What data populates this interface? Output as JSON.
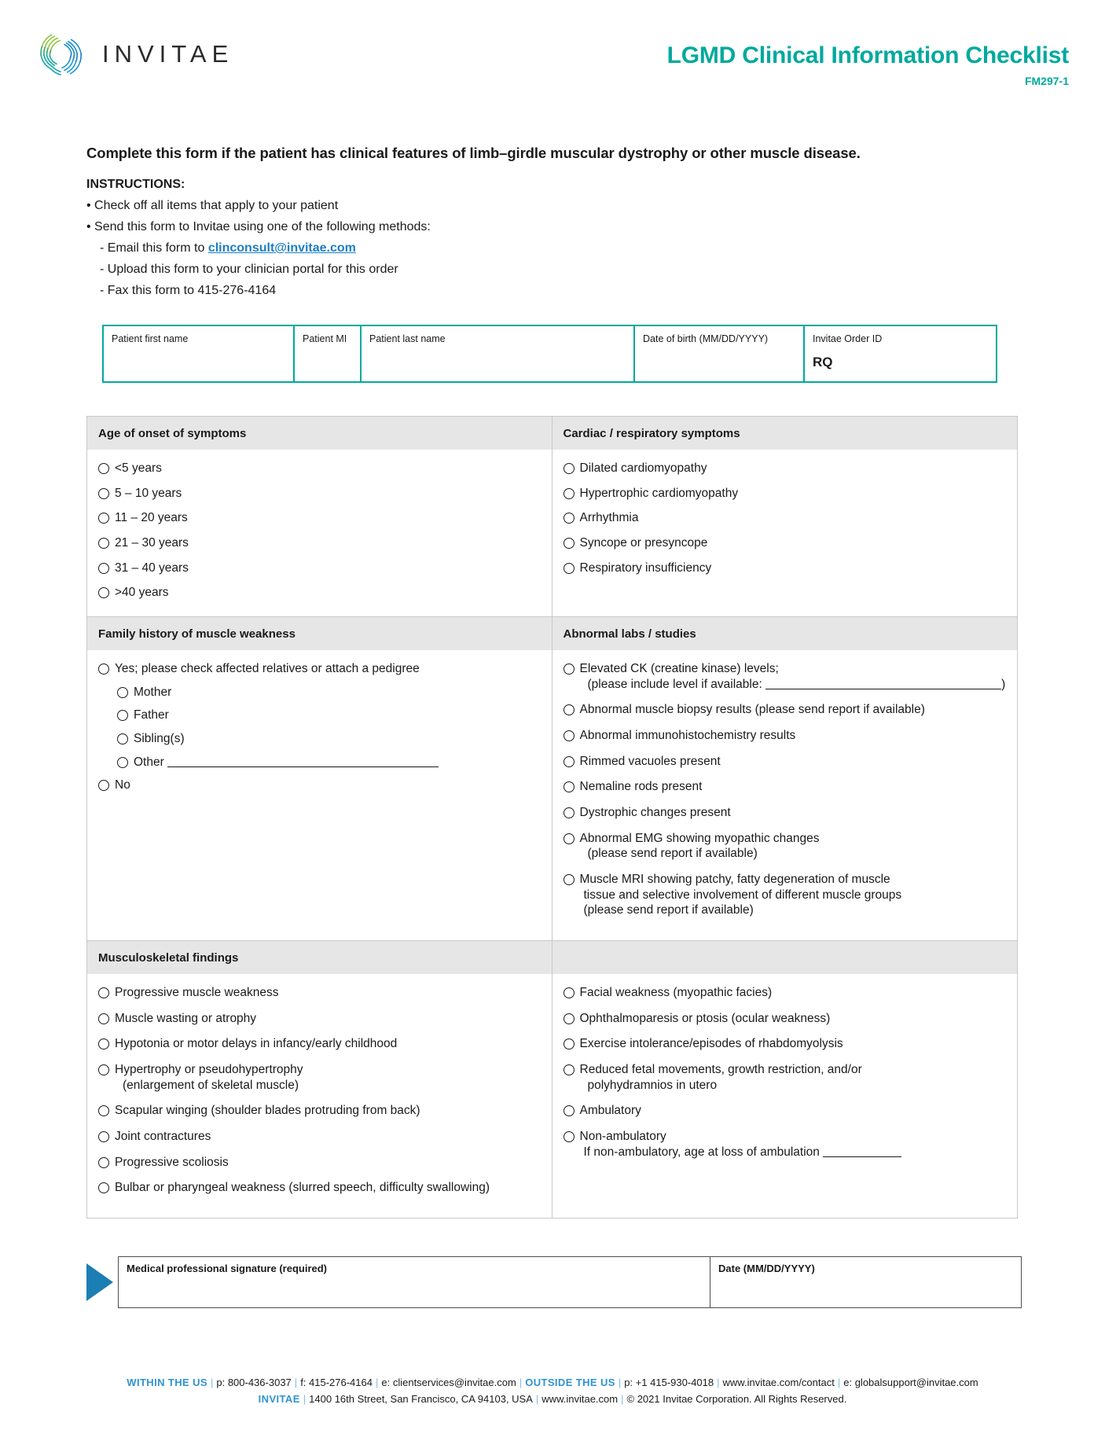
{
  "header": {
    "logo_name": "invitae-logo",
    "wordmark": "INVITAE",
    "doc_title": "LGMD Clinical Information Checklist",
    "doc_code": "FM297-1",
    "accent_color": "#00a99d"
  },
  "instructions": {
    "lede": "Complete this form if the patient has clinical features of limb–girdle muscular dystrophy or other muscle disease.",
    "heading": "INSTRUCTIONS:",
    "bullet1": "• Check off all items that apply to your patient",
    "bullet2": "• Send this form to Invitae using one of the following methods:",
    "sub1_pre": "- Email this form to ",
    "sub1_email": "clinconsult@invitae.com",
    "sub2": "- Upload this form to your clinician portal for this order",
    "sub3": "- Fax this form to 415-276-4164"
  },
  "patient_table": {
    "first_name_label": "Patient first name",
    "first_name_value": "",
    "mi_label": "Patient MI",
    "mi_value": "",
    "last_name_label": "Patient last name",
    "last_name_value": "",
    "dob_label": "Date of birth (MM/DD/YYYY)",
    "dob_value": "",
    "order_id_label": "Invitae Order ID",
    "order_id_value": "RQ"
  },
  "sections": {
    "age_onset": {
      "title": "Age of onset of symptoms",
      "options": [
        "<5 years",
        "5 – 10 years",
        "11 – 20 years",
        "21 – 30 years",
        "31 – 40 years",
        ">40 years"
      ]
    },
    "cardiac": {
      "title": "Cardiac / respiratory symptoms",
      "options": [
        "Dilated cardiomyopathy",
        "Hypertrophic cardiomyopathy",
        "Arrhythmia",
        "Syncope or presyncope",
        "Respiratory insufficiency"
      ]
    },
    "family_history": {
      "title": "Family history of muscle weakness",
      "yes_label": "Yes; please check affected relatives or attach a pedigree",
      "relatives": [
        "Mother",
        "Father",
        "Sibling(s)"
      ],
      "other_label": "Other",
      "no_label": "No"
    },
    "abnormal_labs": {
      "title": "Abnormal labs / studies",
      "ck_line1": "Elevated CK (creatine kinase) levels;",
      "ck_line2_pre": "(please include level if available: ",
      "ck_line2_post": ")",
      "options": [
        "Abnormal muscle biopsy results (please send report if available)",
        "Abnormal immunohistochemistry results",
        "Rimmed vacuoles present",
        "Nemaline rods present",
        "Dystrophic changes present"
      ],
      "emg_line1": "Abnormal EMG showing myopathic changes",
      "emg_line2": "(please send report if available)",
      "mri_line1": "Muscle MRI showing patchy, fatty degeneration of muscle",
      "mri_line2": "tissue and selective involvement of different muscle groups",
      "mri_line3": "(please send report if available)"
    },
    "musculoskeletal": {
      "title": "Musculoskeletal findings",
      "left_options": [
        "Progressive muscle weakness",
        "Muscle wasting or atrophy",
        "Hypotonia or motor delays in infancy/early childhood"
      ],
      "hypertrophy_line1": "Hypertrophy or pseudohypertrophy",
      "hypertrophy_line2": "(enlargement of skeletal muscle)",
      "left_options_2": [
        "Scapular winging (shoulder blades protruding from back)",
        "Joint contractures",
        "Progressive scoliosis",
        "Bulbar or pharyngeal weakness (slurred speech, difficulty swallowing)"
      ],
      "right_options": [
        "Facial weakness (myopathic facies)",
        "Ophthalmoparesis or ptosis (ocular weakness)",
        "Exercise intolerance/episodes of rhabdomyolysis"
      ],
      "fetal_line1": "Reduced fetal movements, growth restriction, and/or",
      "fetal_line2": "polyhydramnios in utero",
      "ambulatory": "Ambulatory",
      "non_ambulatory": "Non-ambulatory",
      "non_ambulatory_note": "If non-ambulatory, age at loss of ambulation"
    }
  },
  "signature": {
    "signature_label": "Medical professional signature (required)",
    "signature_value": "",
    "date_label": "Date (MM/DD/YYYY)",
    "date_value": ""
  },
  "footer": {
    "within_label": "WITHIN THE US",
    "within_phone": "p: 800-436-3037",
    "within_fax": "f: 415-276-4164",
    "within_email": "e: clientservices@invitae.com",
    "outside_label": "OUTSIDE THE US",
    "outside_phone": "p: +1 415-930-4018",
    "outside_web": "www.invitae.com/contact",
    "outside_email": "e: globalsupport@invitae.com",
    "company": "INVITAE",
    "address": "1400 16th Street, San Francisco, CA 94103, USA",
    "website": "www.invitae.com",
    "copyright": "© 2021 Invitae Corporation. All Rights Reserved."
  }
}
